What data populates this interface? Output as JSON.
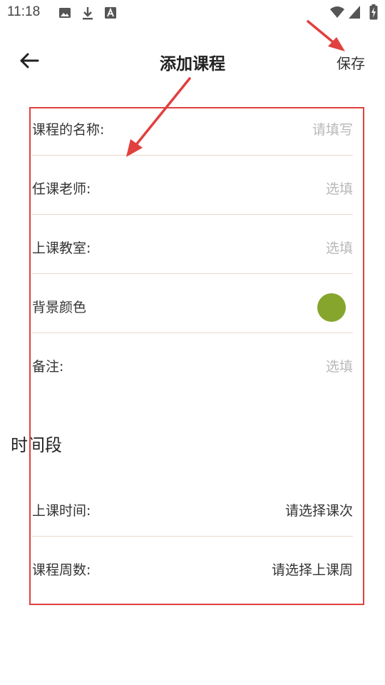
{
  "status_bar": {
    "time": "11:18",
    "icons": [
      "image-icon",
      "download-icon",
      "font-a-icon",
      "wifi-icon",
      "signal-icon",
      "battery-charging-icon"
    ]
  },
  "toolbar": {
    "back_icon": "arrow-left-icon",
    "title": "添加课程",
    "save_label": "保存"
  },
  "form": {
    "course_name": {
      "label": "课程的名称:",
      "placeholder": "请填写"
    },
    "teacher": {
      "label": "任课老师:",
      "placeholder": "选填"
    },
    "classroom": {
      "label": "上课教室:",
      "placeholder": "选填"
    },
    "background_color": {
      "label": "背景颜色",
      "color": "#86a52d"
    },
    "note": {
      "label": "备注:",
      "placeholder": "选填"
    }
  },
  "time_section": {
    "title": "时间段",
    "class_time": {
      "label": "上课时间:",
      "value": "请选择课次"
    },
    "weeks": {
      "label": "课程周数:",
      "value": "请选择上课周"
    }
  },
  "annotation": {
    "color": "#e0403e"
  }
}
